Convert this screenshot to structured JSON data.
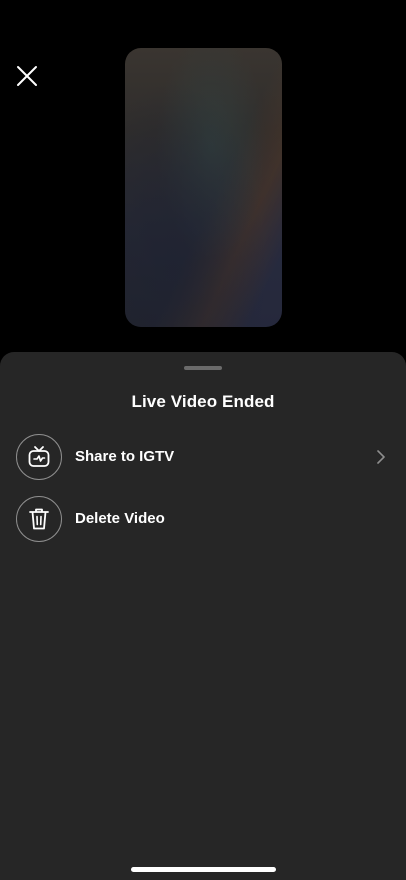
{
  "header": {
    "close_icon": "close-icon"
  },
  "preview": {
    "description_icon": "video-thumbnail"
  },
  "sheet": {
    "title": "Live Video Ended",
    "options": [
      {
        "label": "Share to IGTV",
        "icon": "igtv-icon",
        "has_chevron": true
      },
      {
        "label": "Delete Video",
        "icon": "trash-icon",
        "has_chevron": false
      }
    ]
  },
  "colors": {
    "background": "#000000",
    "sheet": "#262626",
    "text": "#ffffff",
    "icon_border": "#8e8e8e"
  }
}
